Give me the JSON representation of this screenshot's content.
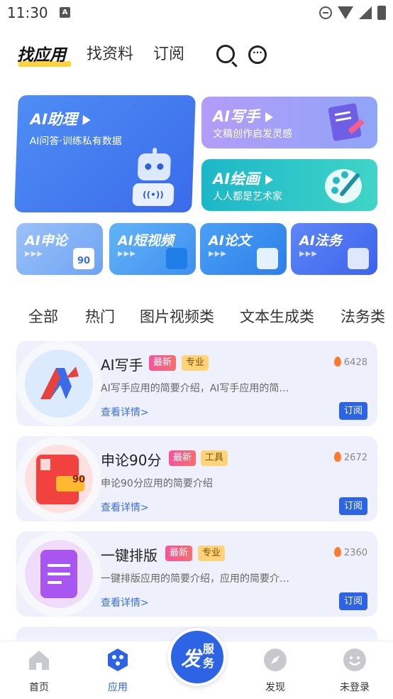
{
  "status_bar": {
    "time": "11:30",
    "notification_icon": "A"
  },
  "header": {
    "tabs": [
      {
        "label": "找应用"
      },
      {
        "label": "找资料"
      },
      {
        "label": "订阅"
      }
    ],
    "accent": "#ffd33d"
  },
  "features": {
    "assistant": {
      "title": "AI助理",
      "subtitle": "AI问答·训练私有数据",
      "robot_text": "((•))"
    },
    "writer": {
      "title": "AI写手",
      "subtitle": "文稿创作启发灵感"
    },
    "painter": {
      "title": "AI绘画",
      "subtitle": "人人都是艺术家"
    },
    "small": [
      {
        "title": "AI申论",
        "arrows": "▶▶▶",
        "icon_text": "90"
      },
      {
        "title": "AI短视频",
        "arrows": "▶▶▶"
      },
      {
        "title": "AI论文",
        "arrows": "▶▶▶"
      },
      {
        "title": "AI法务",
        "arrows": "▶▶▶"
      }
    ]
  },
  "categories": [
    "全部",
    "热门",
    "图片视频类",
    "文本生成类",
    "法务类"
  ],
  "apps": [
    {
      "name": "AI写手",
      "badge_new": "最新",
      "badge_tag": "专业",
      "hot": "6428",
      "desc": "AI写手应用的简要介绍，AI写手应用的简…",
      "more": "查看详情>",
      "button": "订阅"
    },
    {
      "name": "申论90分",
      "badge_new": "最新",
      "badge_tag": "工具",
      "hot": "2672",
      "desc": "申论90分应用的简要介绍",
      "more": "查看详情>",
      "button": "订阅",
      "logo_text": "90"
    },
    {
      "name": "一键排版",
      "badge_new": "最新",
      "badge_tag": "专业",
      "hot": "2360",
      "desc": "一键排版应用的简要介绍，应用的简要介…",
      "more": "查看详情>",
      "button": "订阅"
    }
  ],
  "bottom_nav": {
    "items": [
      {
        "label": "首页"
      },
      {
        "label": "应用"
      },
      {
        "label": "发现"
      },
      {
        "label": "未登录"
      }
    ],
    "fab_big": "发",
    "fab_small": "服务",
    "active_color": "#2c64e5"
  }
}
